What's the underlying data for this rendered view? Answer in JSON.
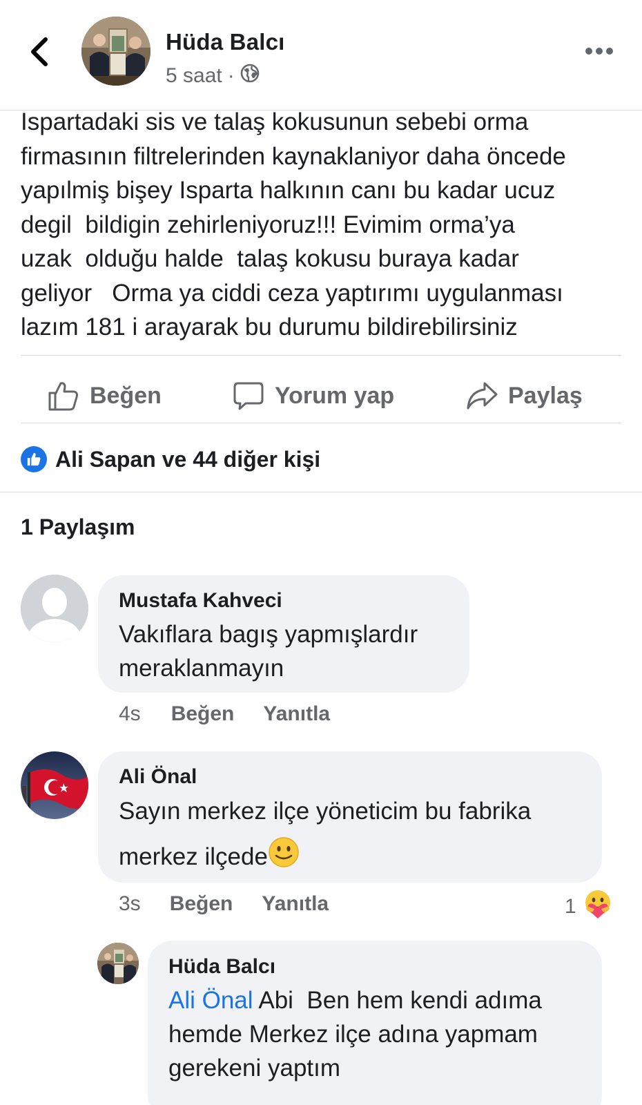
{
  "header": {
    "back_icon": "chevron-left-icon",
    "author_name": "Hüda Balcı",
    "time": "5 saat",
    "separator": "·",
    "audience_icon": "globe-icon",
    "more_icon": "more-horizontal-icon"
  },
  "post": {
    "text": "Ispartadaki sis ve talaş kokusunun sebebi orma\nfirmasının filtrelerinden kaynaklaniyor daha öncede\nyapılmiş bişey Isparta halkının canı bu kadar ucuz\ndegil  bildigin zehirleniyoruz!!! Evimim orma’ya\nuzak  olduğu halde  talaş kokusu buraya kadar\ngeliyor   Orma ya ciddi ceza yaptırımı uygulanması\nlazım 181 i arayarak bu durumu bildirebilirsiniz"
  },
  "actions": {
    "like_label": "Beğen",
    "comment_label": "Yorum yap",
    "share_label": "Paylaş"
  },
  "reactions": {
    "summary": "Ali Sapan ve 44 diğer kişi"
  },
  "shares": {
    "label": "1 Paylaşım"
  },
  "comments": [
    {
      "author": "Mustafa Kahveci",
      "text_line1": "Vakıflara bagış yapmışlardır",
      "text_line2": "meraklanmayın",
      "time": "4s",
      "like_label": "Beğen",
      "reply_label": "Yanıtla"
    },
    {
      "author": "Ali Önal",
      "text_line1": "Sayın merkez ilçe yöneticim bu fabrika",
      "text_line2": "merkez ilçede",
      "emoji": "🙂",
      "time": "3s",
      "like_label": "Beğen",
      "reply_label": "Yanıtla",
      "reaction_count": "1",
      "reaction_icon": "care-reaction-icon"
    }
  ],
  "reply": {
    "author": "Hüda Balcı",
    "mention": "Ali Önal",
    "text_line1": " Abi  Ben hem kendi adıma",
    "text_line2": "hemde Merkez ilçe adına yapmam",
    "text_line3": "gerekeni yaptım"
  },
  "colors": {
    "link_blue": "#1b74e4",
    "secondary_text": "#65676b",
    "bubble_bg": "#f0f2f5"
  }
}
